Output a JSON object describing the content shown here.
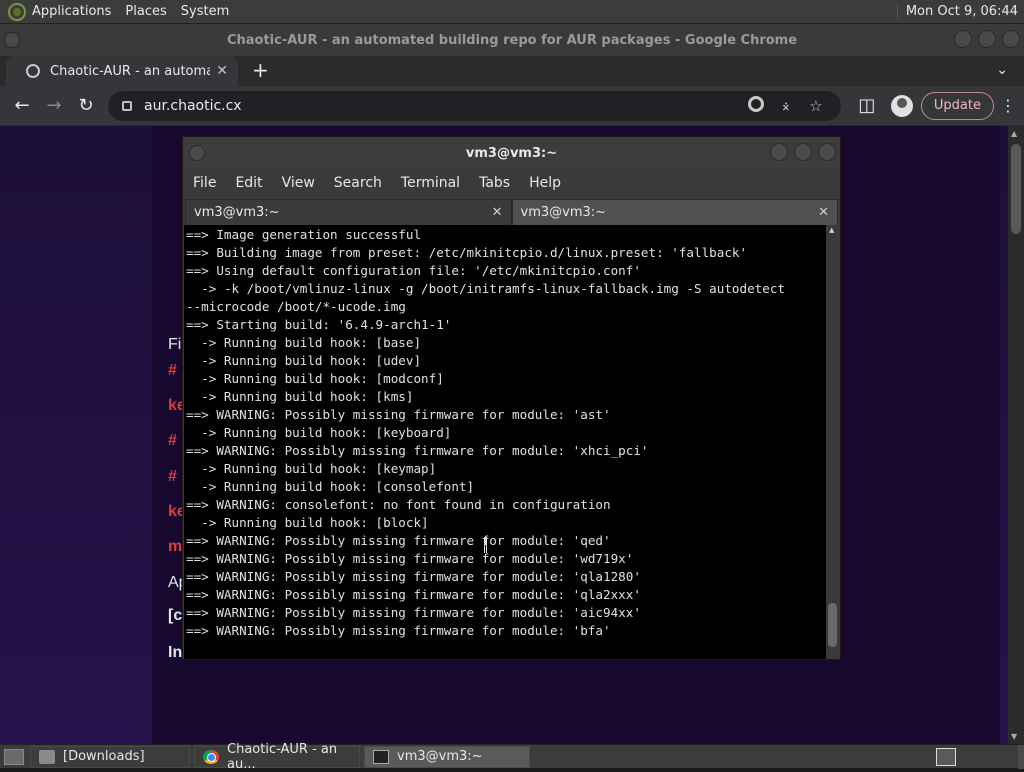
{
  "top_panel": {
    "menus": [
      "Applications",
      "Places",
      "System"
    ],
    "clock": "Mon Oct  9, 06:44"
  },
  "chrome": {
    "window_title": "Chaotic-AUR - an automated building repo for AUR packages - Google Chrome",
    "tab_label": "Chaotic-AUR - an automated b",
    "tab_close": "✕",
    "new_tab": "+",
    "tab_menu": "⌄",
    "url": "aur.chaotic.cx",
    "update_label": "Update",
    "more": "⋮"
  },
  "page": {
    "lines": [
      {
        "text": "Fi",
        "style": "normal"
      },
      {
        "text": "#",
        "style": "red"
      },
      {
        "text": "ke",
        "style": "red"
      },
      {
        "text": "#",
        "style": "red"
      },
      {
        "text": "#",
        "style": "red"
      },
      {
        "text": "ke",
        "style": "red"
      },
      {
        "text": "m",
        "style": "red"
      },
      {
        "text": "Ap",
        "style": "normal"
      },
      {
        "text": "[c",
        "style": "normal"
      },
      {
        "text": "In",
        "style": "normal"
      }
    ]
  },
  "terminal": {
    "window_title": "vm3@vm3:~",
    "menus": [
      "File",
      "Edit",
      "View",
      "Search",
      "Terminal",
      "Tabs",
      "Help"
    ],
    "tabs": [
      {
        "label": "vm3@vm3:~",
        "close": "✕"
      },
      {
        "label": "vm3@vm3:~",
        "close": "✕"
      }
    ],
    "output": [
      "==> Image generation successful",
      "==> Building image from preset: /etc/mkinitcpio.d/linux.preset: 'fallback'",
      "==> Using default configuration file: '/etc/mkinitcpio.conf'",
      "  -> -k /boot/vmlinuz-linux -g /boot/initramfs-linux-fallback.img -S autodetect",
      "--microcode /boot/*-ucode.img",
      "==> Starting build: '6.4.9-arch1-1'",
      "  -> Running build hook: [base]",
      "  -> Running build hook: [udev]",
      "  -> Running build hook: [modconf]",
      "  -> Running build hook: [kms]",
      "==> WARNING: Possibly missing firmware for module: 'ast'",
      "  -> Running build hook: [keyboard]",
      "==> WARNING: Possibly missing firmware for module: 'xhci_pci'",
      "  -> Running build hook: [keymap]",
      "  -> Running build hook: [consolefont]",
      "==> WARNING: consolefont: no font found in configuration",
      "  -> Running build hook: [block]",
      "==> WARNING: Possibly missing firmware for module: 'qed'",
      "==> WARNING: Possibly missing firmware for module: 'wd719x'",
      "==> WARNING: Possibly missing firmware for module: 'qla1280'",
      "==> WARNING: Possibly missing firmware for module: 'qla2xxx'",
      "==> WARNING: Possibly missing firmware for module: 'aic94xx'",
      "==> WARNING: Possibly missing firmware for module: 'bfa'"
    ]
  },
  "taskbar": {
    "tasks": [
      {
        "label": "[Downloads]",
        "icon": "folder-icon"
      },
      {
        "label": "Chaotic-AUR - an au...",
        "icon": "chrome-icon"
      },
      {
        "label": "vm3@vm3:~",
        "icon": "terminal-icon"
      }
    ]
  }
}
